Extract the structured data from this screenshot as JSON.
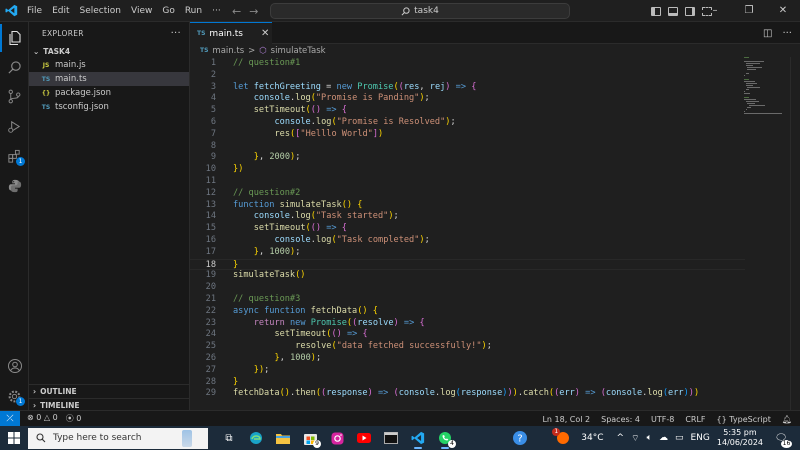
{
  "titlebar": {
    "menu": [
      "File",
      "Edit",
      "Selection",
      "View",
      "Go",
      "Run",
      "···"
    ],
    "search_text": "task4",
    "window_controls": [
      "–",
      "❐",
      "✕"
    ]
  },
  "activity_bar": {
    "icons": [
      "explorer-icon",
      "search-icon",
      "source-control-icon",
      "run-debug-icon",
      "extensions-icon",
      "python-icon",
      "account-icon",
      "settings-gear-icon"
    ],
    "extensions_badge": "1",
    "settings_badge": "1"
  },
  "sidebar": {
    "title": "EXPLORER",
    "more": "···",
    "folder": "TASK4",
    "files": [
      {
        "icon": "JS",
        "name": "main.js",
        "color": "#cbcb41"
      },
      {
        "icon": "TS",
        "name": "main.ts",
        "color": "#519aba"
      },
      {
        "icon": "{}",
        "name": "package.json",
        "color": "#cbcb41"
      },
      {
        "icon": "TS",
        "name": "tsconfig.json",
        "color": "#519aba"
      }
    ],
    "outline": "OUTLINE",
    "timeline": "TIMELINE"
  },
  "editor": {
    "tab": {
      "icon": "TS",
      "label": "main.ts",
      "close": "✕"
    },
    "breadcrumb": {
      "file": "main.ts",
      "separator": ">",
      "symbol": "simulateTask"
    },
    "current_line": 18,
    "line_numbers": [
      "1",
      "2",
      "3",
      "4",
      "5",
      "6",
      "7",
      "8",
      "9",
      "10",
      "11",
      "12",
      "13",
      "14",
      "15",
      "16",
      "17",
      "18",
      "19",
      "20",
      "21",
      "22",
      "23",
      "24",
      "25",
      "26",
      "27",
      "28",
      "29"
    ],
    "code_lines": [
      "// question#1",
      "",
      "let fetchGreeting = new Promise((res, rej) => {",
      "    console.log(\"Promise is Panding\");",
      "    setTimeout(() => {",
      "        console.log(\"Promise is Resolved\");",
      "        res([\"Helllo World\"])",
      "",
      "    }, 2000);",
      "})",
      "",
      "// question#2",
      "function simulateTask() {",
      "    console.log(\"Task started\");",
      "    setTimeout(() => {",
      "        console.log(\"Task completed\");",
      "    }, 1000);",
      "}",
      "simulateTask()",
      "",
      "// question#3",
      "async function fetchData() {",
      "    return new Promise((resolve) => {",
      "        setTimeout(() => {",
      "            resolve(\"data fetched successfully!\");",
      "        }, 1000);",
      "    });",
      "}",
      "fetchData().then((response) => (console.log(response))).catch((err) => (console.log(err)))"
    ]
  },
  "statusbar": {
    "errors": "0",
    "warnings": "0",
    "ports": "0",
    "position": "Ln 18, Col 2",
    "spaces": "Spaces: 4",
    "encoding": "UTF-8",
    "eol": "CRLF",
    "language": "{} TypeScript"
  },
  "taskbar": {
    "search_placeholder": "Type here to search",
    "apps": [
      "task-view-icon",
      "edge-icon",
      "file-explorer-icon",
      "store-icon",
      "instagram-icon",
      "youtube-icon",
      "terminal-icon",
      "vscode-icon",
      "whatsapp-icon"
    ],
    "store_badge": "9",
    "whatsapp_badge": "4",
    "weather_badge": "1",
    "temperature": "34°C",
    "time": "5:35 pm",
    "date": "14/06/2024",
    "notification_badge": "16"
  },
  "colors": {
    "accent": "#0078d4",
    "editor_bg": "#1f1f1f",
    "sidebar_bg": "#181818",
    "taskbar_bg": "#1c2b3a"
  }
}
